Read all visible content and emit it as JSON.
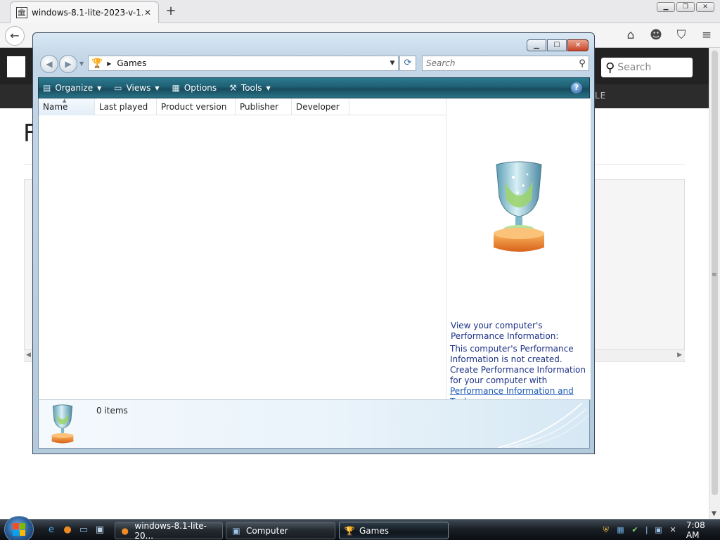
{
  "browser": {
    "tab_title": "windows-8.1-lite-2023-v-1...",
    "tab_close": "✕",
    "new_tab": "+",
    "win_min": "▁",
    "win_restore": "❐",
    "win_close": "✕",
    "back": "←",
    "toolbar_icons": [
      "home-icon",
      "smiley-icon",
      "pocket-icon",
      "menu-icon"
    ]
  },
  "site": {
    "search_placeholder": "Search",
    "nav_fragment": "LE",
    "heading_fragment": "F"
  },
  "games_window": {
    "address": {
      "location": "Games",
      "search_placeholder": "Search"
    },
    "commands": [
      {
        "label": "Organize",
        "icon": "organize-icon"
      },
      {
        "label": "Views",
        "icon": "views-icon"
      },
      {
        "label": "Options",
        "icon": "options-icon"
      },
      {
        "label": "Tools",
        "icon": "tools-icon"
      }
    ],
    "help": "?",
    "columns": [
      "Name",
      "Last played",
      "Product version",
      "Publisher",
      "Developer"
    ],
    "preview": {
      "perf_heading": "View your computer's Performance Information:",
      "perf_line1": "This computer's Performance Information is not created.",
      "perf_line2": "Create Performance Information for your computer with ",
      "perf_link": "Performance Information and Tools",
      "perf_end": "."
    },
    "details": {
      "items_count": "0 items"
    }
  },
  "taskbar": {
    "buttons": [
      {
        "label": "windows-8.1-lite-20...",
        "icon": "firefox-icon"
      },
      {
        "label": "Computer",
        "icon": "computer-icon"
      },
      {
        "label": "Games",
        "icon": "games-icon",
        "active": true
      }
    ],
    "clock": "7:08 AM"
  },
  "colors": {
    "cmdbar": "#1f5e72",
    "link": "#1e3287",
    "taskbar": "#1b2027"
  }
}
